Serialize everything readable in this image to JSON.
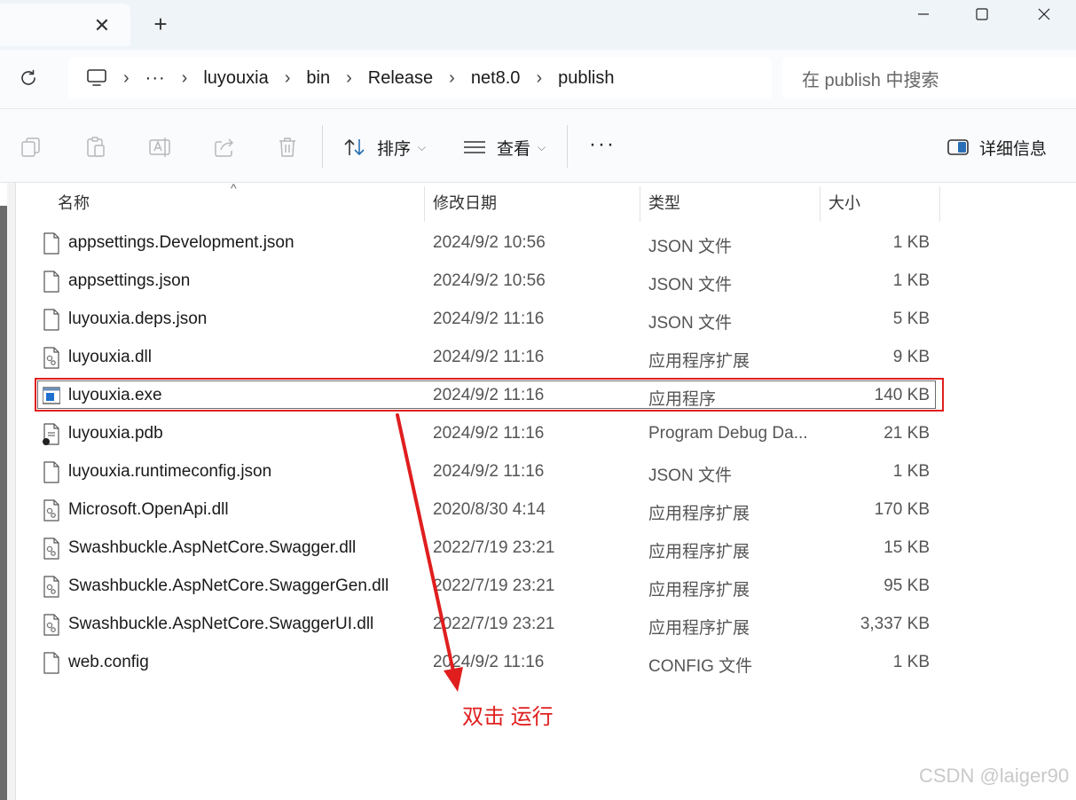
{
  "titlebar": {
    "close_tab_glyph": "✕",
    "new_tab_glyph": "+"
  },
  "address": {
    "overflow": "···",
    "crumbs": [
      "luyouxia",
      "bin",
      "Release",
      "net8.0",
      "publish"
    ],
    "search_placeholder": "在 publish 中搜索"
  },
  "toolbar": {
    "sort_label": "排序",
    "view_label": "查看",
    "more_label": "···",
    "details_label": "详细信息"
  },
  "columns": {
    "name": "名称",
    "date": "修改日期",
    "type": "类型",
    "size": "大小"
  },
  "files": [
    {
      "name": "appsettings.Development.json",
      "date": "2024/9/2 10:56",
      "type": "JSON 文件",
      "size": "1 KB",
      "icon": "file-icon"
    },
    {
      "name": "appsettings.json",
      "date": "2024/9/2 10:56",
      "type": "JSON 文件",
      "size": "1 KB",
      "icon": "file-icon"
    },
    {
      "name": "luyouxia.deps.json",
      "date": "2024/9/2 11:16",
      "type": "JSON 文件",
      "size": "5 KB",
      "icon": "file-icon"
    },
    {
      "name": "luyouxia.dll",
      "date": "2024/9/2 11:16",
      "type": "应用程序扩展",
      "size": "9 KB",
      "icon": "dll-icon"
    },
    {
      "name": "luyouxia.exe",
      "date": "2024/9/2 11:16",
      "type": "应用程序",
      "size": "140 KB",
      "icon": "exe-icon"
    },
    {
      "name": "luyouxia.pdb",
      "date": "2024/9/2 11:16",
      "type": "Program Debug Da...",
      "size": "21 KB",
      "icon": "pdb-icon"
    },
    {
      "name": "luyouxia.runtimeconfig.json",
      "date": "2024/9/2 11:16",
      "type": "JSON 文件",
      "size": "1 KB",
      "icon": "file-icon"
    },
    {
      "name": "Microsoft.OpenApi.dll",
      "date": "2020/8/30 4:14",
      "type": "应用程序扩展",
      "size": "170 KB",
      "icon": "dll-icon"
    },
    {
      "name": "Swashbuckle.AspNetCore.Swagger.dll",
      "date": "2022/7/19 23:21",
      "type": "应用程序扩展",
      "size": "15 KB",
      "icon": "dll-icon"
    },
    {
      "name": "Swashbuckle.AspNetCore.SwaggerGen.dll",
      "date": "2022/7/19 23:21",
      "type": "应用程序扩展",
      "size": "95 KB",
      "icon": "dll-icon"
    },
    {
      "name": "Swashbuckle.AspNetCore.SwaggerUI.dll",
      "date": "2022/7/19 23:21",
      "type": "应用程序扩展",
      "size": "3,337 KB",
      "icon": "dll-icon"
    },
    {
      "name": "web.config",
      "date": "2024/9/2 11:16",
      "type": "CONFIG 文件",
      "size": "1 KB",
      "icon": "file-icon"
    }
  ],
  "annotation": "双击 运行",
  "watermark": "CSDN @laiger90",
  "colors": {
    "annotation_red": "#e01e1e",
    "toolbar_bg": "#f9fbfd",
    "titlebar_bg": "#eff4f9"
  }
}
